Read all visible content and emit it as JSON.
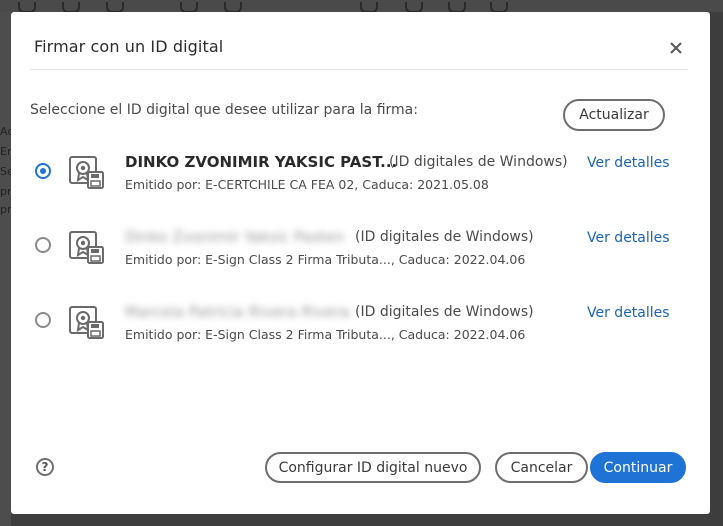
{
  "dialog": {
    "title": "Firmar con un ID digital",
    "prompt": "Seleccione el ID digital que desee utilizar para la firma:",
    "refresh_label": "Actualizar",
    "help_label": "?",
    "configure_label": "Configurar ID digital nuevo",
    "cancel_label": "Cancelar",
    "continue_label": "Continuar",
    "accent_color": "#1f73d4"
  },
  "background": {
    "left_glyphs": [
      "Ac",
      "En",
      "Se",
      "pr",
      "pro"
    ]
  },
  "certificates": [
    {
      "name": "DINKO ZVONIMIR YAKSIC PAST...",
      "name_obscured": false,
      "type": "(ID digitales de Windows)",
      "issuer": "Emitido por: E-CERTCHILE CA FEA 02, Caduca: 2021.05.08",
      "details_label": "Ver detalles",
      "selected": true,
      "icon": "certificate-icon"
    },
    {
      "name": "Dinko Zvonimir Yaksic Pasten",
      "name_obscured": true,
      "type": "(ID digitales de Windows)",
      "issuer": "Emitido por: E-Sign Class 2 Firma Tributa..., Caduca: 2022.04.06",
      "details_label": "Ver detalles",
      "selected": false,
      "icon": "certificate-icon"
    },
    {
      "name": "Marcela Patricia Rivera Rivera",
      "name_obscured": true,
      "type": "(ID digitales de Windows)",
      "issuer": "Emitido por: E-Sign Class 2 Firma Tributa..., Caduca: 2022.04.06",
      "details_label": "Ver detalles",
      "selected": false,
      "icon": "certificate-icon"
    }
  ]
}
